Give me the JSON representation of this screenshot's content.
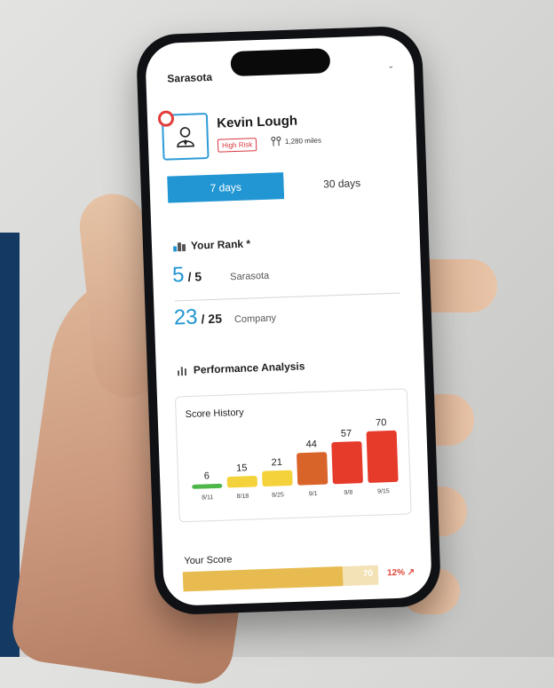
{
  "app": {
    "city_select": "Sarasota"
  },
  "profile": {
    "name": "Kevin Lough",
    "risk_badge": "High Risk",
    "miles": "1,280 miles",
    "colors": {
      "accent": "#2196d3",
      "risk": "#d8363f"
    }
  },
  "tabs": [
    {
      "label": "7 days",
      "active": true
    },
    {
      "label": "30 days",
      "active": false
    }
  ],
  "rank": {
    "title": "Your Rank *",
    "rows": [
      {
        "rank": "5",
        "total": "/ 5",
        "label": "Sarasota"
      },
      {
        "rank": "23",
        "total": "/ 25",
        "label": "Company"
      }
    ]
  },
  "performance": {
    "title": "Performance Analysis"
  },
  "chart_data": {
    "type": "bar",
    "title": "Score History",
    "categories": [
      "8/11",
      "8/18",
      "8/25",
      "9/1",
      "9/8",
      "9/15"
    ],
    "values": [
      6,
      15,
      21,
      44,
      57,
      70
    ],
    "colors": [
      "#4cb648",
      "#f4d23b",
      "#f4d23b",
      "#d9642a",
      "#e63a2b",
      "#e63a2b"
    ],
    "ylim": [
      0,
      70
    ]
  },
  "score": {
    "label": "Your Score",
    "value": "70",
    "fraction": 0.82,
    "change": "12%",
    "change_icon": "trend-up-icon",
    "colors": {
      "fill": "#e7bb4f",
      "track": "#f3e2b6",
      "change": "#e0473b"
    }
  }
}
